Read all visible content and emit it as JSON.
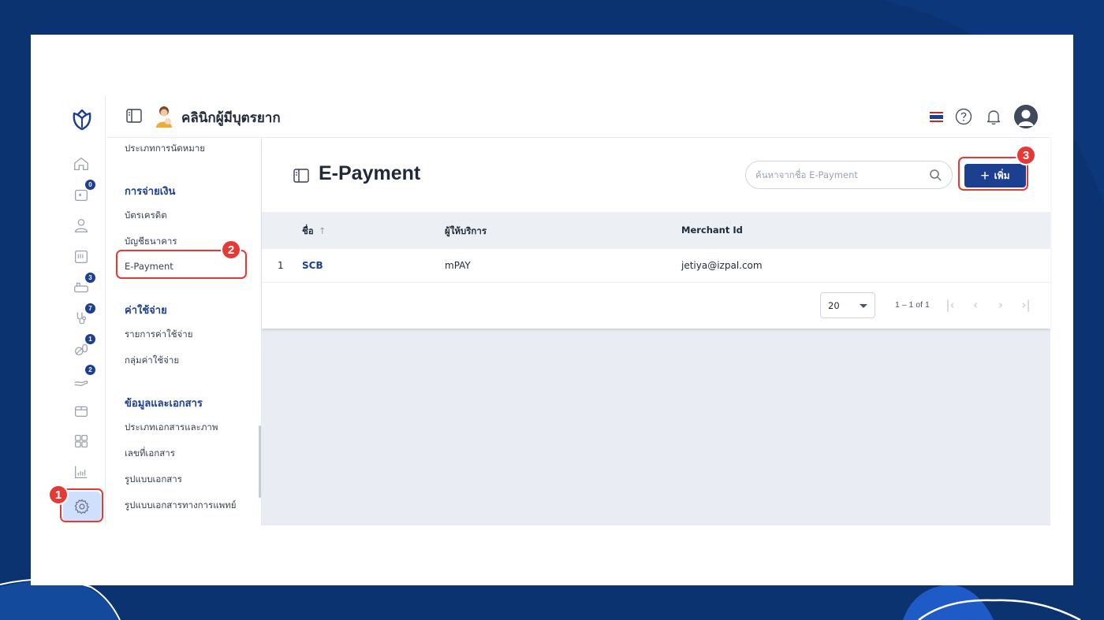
{
  "clinic": {
    "name": "คลินิกผู้มีบุตรยาก"
  },
  "rail": {
    "badges": {
      "appointments": "0",
      "treatment": "3",
      "stethoscope": "7",
      "medicine": "1",
      "service": "2"
    }
  },
  "callouts": {
    "settings": "1",
    "epayment": "2",
    "add": "3"
  },
  "submenu": {
    "items_top": [
      "ประเภทการนัดหมาย"
    ],
    "payment_section": "การจ่ายเงิน",
    "payment_items": [
      "บัตรเครดิต",
      "บัญชีธนาคาร",
      "E-Payment"
    ],
    "expense_section": "ค่าใช้จ่าย",
    "expense_items": [
      "รายการค่าใช้จ่าย",
      "กลุ่มค่าใช้จ่าย"
    ],
    "docs_section": "ข้อมูลและเอกสาร",
    "docs_items": [
      "ประเภทเอกสารและภาพ",
      "เลขที่เอกสาร",
      "รูปแบบเอกสาร",
      "รูปแบบเอกสารทางการแพทย์"
    ]
  },
  "page": {
    "title": "E-Payment",
    "search_placeholder": "ค้นหาจากชื่อ E-Payment",
    "add_label": "เพิ่ม",
    "add_plus": "+"
  },
  "table": {
    "columns": [
      "ชื่อ",
      "ผู้ให้บริการ",
      "Merchant Id"
    ],
    "sort_indicator": "↑",
    "rows": [
      {
        "index": "1",
        "name": "SCB",
        "provider": "mPAY",
        "merchant_id": "jetiya@izpal.com"
      }
    ]
  },
  "pagination": {
    "page_size": "20",
    "range": "1 – 1 of 1"
  },
  "colors": {
    "primary": "#1d3f8f",
    "background": "#0a3370",
    "callout": "#e53935",
    "settings_highlight": "#cfe0ff"
  }
}
